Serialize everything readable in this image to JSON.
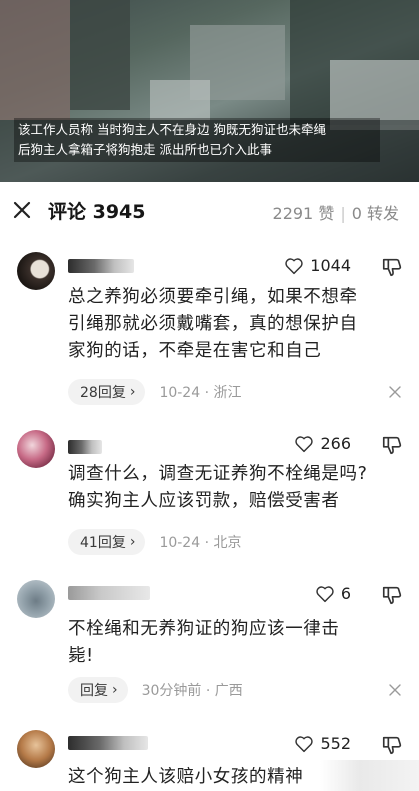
{
  "video": {
    "caption_lines": [
      "该工作人员称 当时狗主人不在身边 狗既无狗证也未牵绳",
      "后狗主人拿箱子将狗抱走 派出所也已介入此事"
    ]
  },
  "header": {
    "title": "评论 3945",
    "likes": "2291 赞",
    "shares": "0 转发"
  },
  "comments": [
    {
      "likes": "1044",
      "text_lines": [
        "总之养狗必须要牵引绳，如果不想牵",
        "引绳那就必须戴嘴套，真的想保护自",
        "家狗的话，不牵是在害它和自己"
      ],
      "reply": "28回复",
      "time_loc": "10-24 · 浙江"
    },
    {
      "likes": "266",
      "text_lines": [
        "调查什么，调查无证养狗不栓绳是吗?",
        "确实狗主人应该罚款，赔偿受害者"
      ],
      "reply": "41回复",
      "time_loc": "10-24 · 北京"
    },
    {
      "likes": "6",
      "text_lines": [
        "不栓绳和无养狗证的狗应该一律击",
        "毙!"
      ],
      "reply": "回复",
      "time_loc": "30分钟前 · 广西"
    },
    {
      "likes": "552",
      "text_lines": [
        "这个狗主人该赔小女孩的精神"
      ],
      "reply": "",
      "time_loc": ""
    }
  ],
  "icons": {
    "close": "close-icon",
    "like": "heart-outline-icon",
    "dislike": "thumbs-down-outline-icon",
    "reply_chevron": "chevron-right-icon",
    "dismiss": "x-icon"
  },
  "colors": {
    "text": "#222222",
    "muted": "#9a9a9a",
    "pill_bg": "#f2f2f2"
  }
}
